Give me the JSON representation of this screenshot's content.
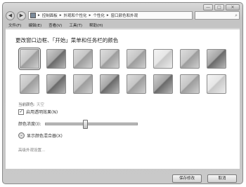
{
  "window": {
    "min_label": "—",
    "max_label": "□",
    "close_label": "✕"
  },
  "address": {
    "back_glyph": "◀",
    "forward_glyph": "▶",
    "crumbs": [
      "控制面板",
      "外观和个性化",
      "个性化",
      "窗口颜色和外观"
    ],
    "separator": "▸",
    "search_glyph": "⌕"
  },
  "menu": [
    "文件(F)",
    "编辑(E)",
    "查看(V)",
    "工具(T)",
    "帮助(H)"
  ],
  "heading": "更改窗口边框、「开始」菜单和任务栏的颜色",
  "swatches": {
    "row1": [
      "selected",
      "dark",
      "normal",
      "normal",
      "normal",
      "light",
      "normal",
      "dark"
    ],
    "row2": [
      "normal",
      "dark",
      "normal",
      "dark",
      "normal",
      "dark",
      "normal",
      "light"
    ]
  },
  "current_color": {
    "label": "当前颜色:",
    "value": "天空"
  },
  "transparency": {
    "label": "启用透明效果(N)",
    "checked": true
  },
  "intensity": {
    "label": "颜色浓度(I):",
    "level": 0.42
  },
  "mixer": {
    "label": "显示颜色混合器(X)"
  },
  "advanced_link": "高级外观设置...",
  "buttons": {
    "save": "保存修改",
    "cancel": "取消"
  }
}
